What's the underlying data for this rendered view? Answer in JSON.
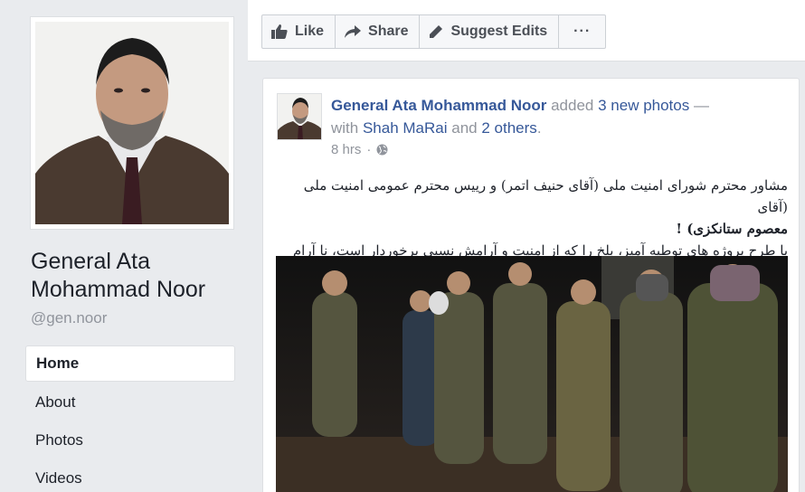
{
  "profile": {
    "name": "General Ata Mohammad Noor",
    "username": "@gen.noor"
  },
  "nav": {
    "items": [
      {
        "label": "Home"
      },
      {
        "label": "About"
      },
      {
        "label": "Photos"
      },
      {
        "label": "Videos"
      }
    ],
    "active": "Home"
  },
  "actions": {
    "like": "Like",
    "share": "Share",
    "suggest": "Suggest Edits",
    "more": "···"
  },
  "post": {
    "author": "General Ata Mohammad Noor",
    "action_added": "added",
    "photo_count": "3 new photos",
    "dash": "—",
    "with": "with",
    "tagged": "Shah MaRai",
    "and": "and",
    "others": "2 others",
    "period": ".",
    "time": "8 hrs",
    "privacy_icon": "globe-icon",
    "text_line1": "مشاور محترم شورای امنیت ملی (آقای حنیف اتمر) و رییس محترم عمومی امنیت ملی (آقای",
    "text_line2": "معصوم ستانکزی) !",
    "text_line3": "با طرح پروژه های توطیه آمیز، بلخ را که از امنیت و آرامش نسبی برخوردار است، نا آرام نسازید."
  },
  "colors": {
    "link": "#365899",
    "muted": "#90949c",
    "background": "#e9ebee"
  }
}
